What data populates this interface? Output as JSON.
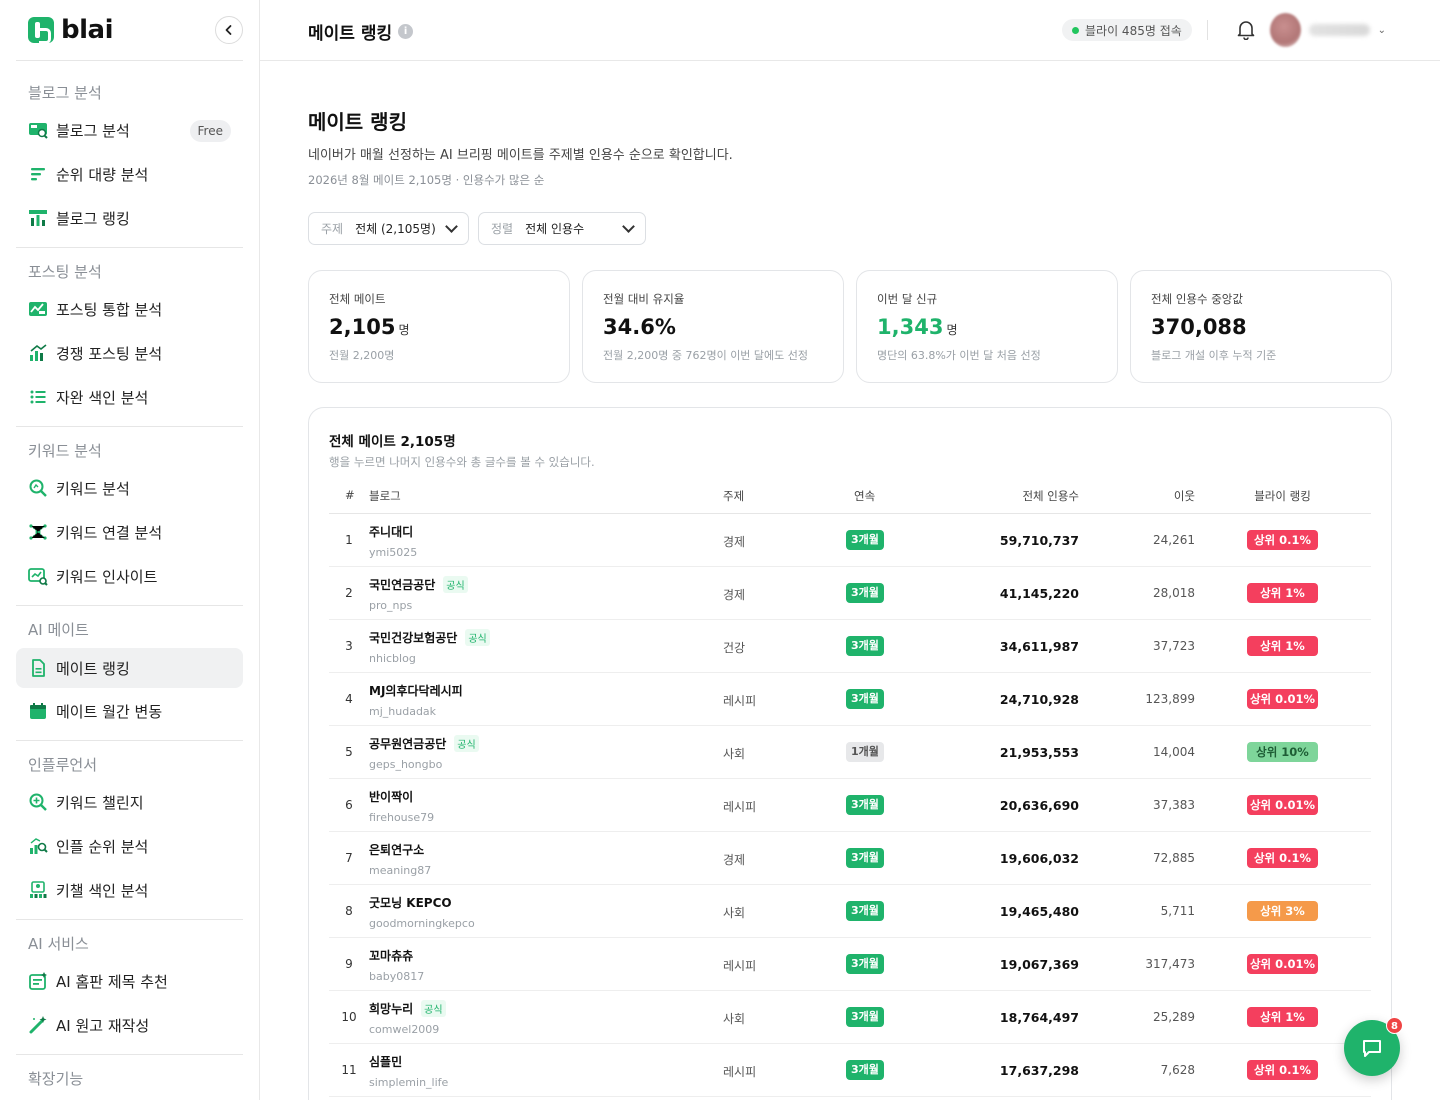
{
  "brand": {
    "name": "blai"
  },
  "sidebar": {
    "sections": [
      {
        "title": "블로그 분석",
        "items": [
          {
            "label": "블로그 분석",
            "icon": "blog-analysis-icon",
            "badge": "Free"
          },
          {
            "label": "순위 대량 분석",
            "icon": "bulk-rank-icon"
          },
          {
            "label": "블로그 랭킹",
            "icon": "blog-ranking-icon"
          }
        ]
      },
      {
        "title": "포스팅 분석",
        "items": [
          {
            "label": "포스팅 통합 분석",
            "icon": "posting-analysis-icon"
          },
          {
            "label": "경쟁 포스팅 분석",
            "icon": "competitor-posting-icon"
          },
          {
            "label": "자완 색인 분석",
            "icon": "list-icon"
          }
        ]
      },
      {
        "title": "키워드 분석",
        "items": [
          {
            "label": "키워드 분석",
            "icon": "keyword-search-icon"
          },
          {
            "label": "키워드 연결 분석",
            "icon": "keyword-network-icon"
          },
          {
            "label": "키워드 인사이트",
            "icon": "keyword-insight-icon"
          }
        ]
      },
      {
        "title": "AI 메이트",
        "items": [
          {
            "label": "메이트 랭킹",
            "icon": "document-icon",
            "active": true
          },
          {
            "label": "메이트 월간 변동",
            "icon": "calendar-icon"
          }
        ]
      },
      {
        "title": "인플루언서",
        "items": [
          {
            "label": "키워드 챌린지",
            "icon": "keyword-challenge-icon"
          },
          {
            "label": "인플 순위 분석",
            "icon": "influencer-rank-icon"
          },
          {
            "label": "키챌 색인 분석",
            "icon": "challenge-index-icon"
          }
        ]
      },
      {
        "title": "AI 서비스",
        "items": [
          {
            "label": "AI 홈판 제목 추천",
            "icon": "title-recommend-icon"
          },
          {
            "label": "AI 원고 재작성",
            "icon": "magic-wand-icon"
          }
        ]
      },
      {
        "title": "확장기능",
        "items": []
      }
    ]
  },
  "topbar": {
    "title": "메이트 랭킹",
    "online": "블라이 485명 접속"
  },
  "page": {
    "title": "메이트 랭킹",
    "description": "네이버가 매월 선정하는 AI 브리핑 메이트를 주제별 인용수 순으로 확인합니다.",
    "meta": "2026년 8월 메이트 2,105명 · 인용수가 많은 순"
  },
  "filters": [
    {
      "key": "주제",
      "value": "전체 (2,105명)"
    },
    {
      "key": "정렬",
      "value": "전체 인용수"
    }
  ],
  "stats": [
    {
      "label": "전체 메이트",
      "value": "2,105",
      "unit": "명",
      "sub": "전월 2,200명",
      "highlight": false
    },
    {
      "label": "전월 대비 유지율",
      "value": "34.6%",
      "unit": "",
      "sub": "전월 2,200명 중 762명이 이번 달에도 선정",
      "highlight": false
    },
    {
      "label": "이번 달 신규",
      "value": "1,343",
      "unit": "명",
      "sub": "명단의 63.8%가 이번 달 처음 선정",
      "highlight": true
    },
    {
      "label": "전체 인용수 중앙값",
      "value": "370,088",
      "unit": "",
      "sub": "블로그 개설 이후 누적 기준",
      "highlight": false
    }
  ],
  "table": {
    "title": "전체 메이트 2,105명",
    "subtitle": "행을 누르면 나머지 인용수와 총 글수를 볼 수 있습니다.",
    "columns": [
      "#",
      "블로그",
      "주제",
      "연속",
      "전체 인용수",
      "이웃",
      "블라이 랭킹"
    ],
    "official_label": "공식",
    "rows": [
      {
        "rank": "1",
        "name": "주니대디",
        "id": "ymi5025",
        "official": false,
        "topic": "경제",
        "streak": "3개월",
        "streak_style": "green",
        "citations": "59,710,737",
        "neighbors": "24,261",
        "tier": "상위 0.1%",
        "tier_style": "red"
      },
      {
        "rank": "2",
        "name": "국민연금공단",
        "id": "pro_nps",
        "official": true,
        "topic": "경제",
        "streak": "3개월",
        "streak_style": "green",
        "citations": "41,145,220",
        "neighbors": "28,018",
        "tier": "상위 1%",
        "tier_style": "red"
      },
      {
        "rank": "3",
        "name": "국민건강보험공단",
        "id": "nhicblog",
        "official": true,
        "topic": "건강",
        "streak": "3개월",
        "streak_style": "green",
        "citations": "34,611,987",
        "neighbors": "37,723",
        "tier": "상위 1%",
        "tier_style": "red"
      },
      {
        "rank": "4",
        "name": "MJ의후다닥레시피",
        "id": "mj_hudadak",
        "official": false,
        "topic": "레시피",
        "streak": "3개월",
        "streak_style": "green",
        "citations": "24,710,928",
        "neighbors": "123,899",
        "tier": "상위 0.01%",
        "tier_style": "red"
      },
      {
        "rank": "5",
        "name": "공무원연금공단",
        "id": "geps_hongbo",
        "official": true,
        "topic": "사회",
        "streak": "1개월",
        "streak_style": "neutral",
        "citations": "21,953,553",
        "neighbors": "14,004",
        "tier": "상위 10%",
        "tier_style": "green"
      },
      {
        "rank": "6",
        "name": "반이짝이",
        "id": "firehouse79",
        "official": false,
        "topic": "레시피",
        "streak": "3개월",
        "streak_style": "green",
        "citations": "20,636,690",
        "neighbors": "37,383",
        "tier": "상위 0.01%",
        "tier_style": "red"
      },
      {
        "rank": "7",
        "name": "은퇴연구소",
        "id": "meaning87",
        "official": false,
        "topic": "경제",
        "streak": "3개월",
        "streak_style": "green",
        "citations": "19,606,032",
        "neighbors": "72,885",
        "tier": "상위 0.1%",
        "tier_style": "red"
      },
      {
        "rank": "8",
        "name": "굿모닝 KEPCO",
        "id": "goodmorningkepco",
        "official": false,
        "topic": "사회",
        "streak": "3개월",
        "streak_style": "green",
        "citations": "19,465,480",
        "neighbors": "5,711",
        "tier": "상위 3%",
        "tier_style": "orange"
      },
      {
        "rank": "9",
        "name": "꼬마츄츄",
        "id": "baby0817",
        "official": false,
        "topic": "레시피",
        "streak": "3개월",
        "streak_style": "green",
        "citations": "19,067,369",
        "neighbors": "317,473",
        "tier": "상위 0.01%",
        "tier_style": "red"
      },
      {
        "rank": "10",
        "name": "희망누리",
        "id": "comwel2009",
        "official": true,
        "topic": "사회",
        "streak": "3개월",
        "streak_style": "green",
        "citations": "18,764,497",
        "neighbors": "25,289",
        "tier": "상위 1%",
        "tier_style": "red"
      },
      {
        "rank": "11",
        "name": "심플민",
        "id": "simplemin_life",
        "official": false,
        "topic": "레시피",
        "streak": "3개월",
        "streak_style": "green",
        "citations": "17,637,298",
        "neighbors": "7,628",
        "tier": "상위 0.1%",
        "tier_style": "red"
      }
    ]
  },
  "chat": {
    "badge": "8"
  },
  "colors": {
    "brand": "#1fb36b",
    "rank_red": "#f43f5e",
    "rank_orange": "#f59a4a",
    "rank_green": "#7ed59a"
  }
}
